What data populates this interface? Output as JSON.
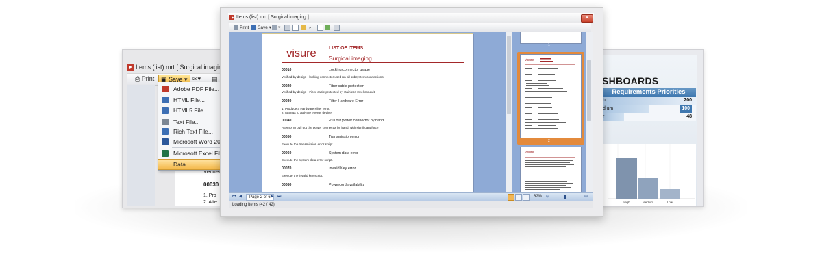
{
  "left_window": {
    "title": "Items (list).mrt  [ Surgical imaging",
    "toolbar": {
      "print": "Print",
      "save": "Save"
    },
    "menu": [
      {
        "label": "Adobe PDF File...",
        "icon": "pdf-icon",
        "color": "#c0392b"
      },
      {
        "label": "HTML File...",
        "icon": "html-icon",
        "color": "#3d6fb4"
      },
      {
        "label": "HTML5 File...",
        "icon": "html5-icon",
        "color": "#3d6fb4"
      },
      {
        "label": "Text File...",
        "icon": "text-file-icon",
        "color": "#7c8794"
      },
      {
        "label": "Rich Text File...",
        "icon": "rtf-icon",
        "color": "#3d6fb4"
      },
      {
        "label": "Microsoft Word 2007/",
        "icon": "word-icon",
        "color": "#2b579a"
      },
      {
        "label": "Microsoft Excel File...",
        "icon": "excel-icon",
        "color": "#217346"
      },
      {
        "label": "Data",
        "icon": "",
        "color": ""
      }
    ],
    "page_text": {
      "verified": "Verified",
      "code": "00030",
      "li1": "1.   Pro",
      "li2": "2.   Atte"
    }
  },
  "center_window": {
    "title": "Items (list).mrt  [ Surgical imaging ]",
    "toolbar": {
      "print": "Print",
      "save": "Save"
    },
    "report": {
      "logo": "visure",
      "title": "LIST OF ITEMS",
      "subtitle": "Surgical imaging",
      "items": [
        {
          "code": "00010",
          "name": "Locking connector usage",
          "desc": "Verified by design - locking connector used on all subsystem connections."
        },
        {
          "code": "00020",
          "name": "Fiber cable protection",
          "desc": "Verified by design - Fiber cable protected by stainless steel conduit."
        },
        {
          "code": "00030",
          "name": "Filter Hardware Error",
          "desc": "1.   Produce a Hardware Filter error.",
          "desc2": "2.   Attempt to activate energy device."
        },
        {
          "code": "00040",
          "name": "Pull out power connector by hand",
          "desc": "Attempt to pull out the power connector by hand, with significant force."
        },
        {
          "code": "00050",
          "name": "Transmission error",
          "desc": "Execute the transmission error script."
        },
        {
          "code": "00060",
          "name": "System data error",
          "desc": "Execute the system data error script."
        },
        {
          "code": "00070",
          "name": "Invalid Key error",
          "desc": "Execute the invalid key script."
        },
        {
          "code": "00080",
          "name": "Powercord availability",
          "desc": ""
        }
      ]
    },
    "nav": {
      "page_label": "Page 2 of 6"
    },
    "zoom": "82%",
    "thumb_numbers": [
      "1",
      "2"
    ],
    "status": "Loading Items (42 / 42)"
  },
  "right_window": {
    "heading": "SHBOARDS",
    "table_title": "Requirements Priorities",
    "rows": [
      {
        "label": "h",
        "value": "200",
        "bar_fraction": 1.0
      },
      {
        "label": "dium",
        "value": "100",
        "bar_fraction": 0.5
      },
      {
        "label": "r",
        "value": "48",
        "bar_fraction": 0.24
      }
    ],
    "chart_labels": [
      "High",
      "Medium",
      "Low"
    ]
  },
  "colors": {
    "accent": "#a3282a",
    "viewer_bg": "#8eaad6",
    "selection": "#f4b849"
  }
}
